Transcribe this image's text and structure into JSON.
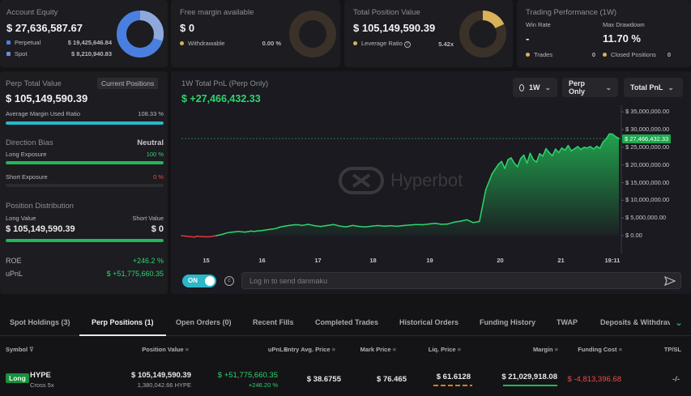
{
  "equity": {
    "label": "Account Equity",
    "value": "$ 27,636,587.67",
    "perp_label": "Perpetual",
    "perp_value": "$ 19,425,646.84",
    "spot_label": "Spot",
    "spot_value": "$ 8,210,940.83"
  },
  "margin": {
    "label": "Free margin available",
    "value": "$ 0",
    "withdrawable_label": "Withdrawable",
    "withdrawable_value": "0.00 %"
  },
  "position": {
    "label": "Total Position Value",
    "value": "$ 105,149,590.39",
    "leverage_label": "Leverage Ratio",
    "leverage_value": "5.42x"
  },
  "performance": {
    "label": "Trading Performance (1W)",
    "win_rate_label": "Win Rate",
    "win_rate_value": "-",
    "drawdown_label": "Max Drawdown",
    "drawdown_value": "11.70 %",
    "trades_label": "Trades",
    "trades_value": "0",
    "closed_label": "Closed Positions",
    "closed_value": "0"
  },
  "perp": {
    "label": "Perp Total Value",
    "current_btn": "Current Positions",
    "value": "$ 105,149,590.39",
    "margin_ratio_label": "Average Margin Used Ratio",
    "margin_ratio_value": "108.33 %",
    "bias_label": "Direction Bias",
    "bias_value": "Neutral",
    "long_label": "Long Exposure",
    "long_value": "100 %",
    "short_label": "Short Exposure",
    "short_value": "0 %",
    "dist_label": "Position Distribution",
    "long_value_label": "Long Value",
    "short_value_label": "Short Value",
    "long_amount": "$ 105,149,590.39",
    "short_amount": "$ 0",
    "roe_label": "ROE",
    "roe_value": "+246.2 %",
    "upnl_label": "uPnL",
    "upnl_value": "$ +51,775,660.35"
  },
  "chart": {
    "title": "1W Total PnL (Perp Only)",
    "value": "$ +27,466,432.33",
    "range_label": "1W",
    "filter_label": "Perp Only",
    "metric_label": "Total PnL",
    "watermark": "Hyperbot",
    "toggle_label": "ON",
    "danmaku_placeholder": "Log in to send danmaku"
  },
  "chart_data": {
    "type": "area",
    "x_ticks": [
      "15",
      "16",
      "17",
      "18",
      "19",
      "20",
      "21",
      "19:11"
    ],
    "y_ticks": [
      "$ 35,000,000.00",
      "$ 30,000,000.00",
      "$ 25,000,000.00",
      "$ 20,000,000.00",
      "$ 15,000,000.00",
      "$ 10,000,000.00",
      "$ 5,000,000.00",
      "$ 0.00"
    ],
    "ylim": [
      0,
      35000000
    ],
    "current_label": "$ 27,466,432.33",
    "current_value": 27466432.33,
    "x": [
      0,
      0.05,
      0.1,
      0.15,
      0.2,
      0.25,
      0.3,
      0.35,
      0.4,
      0.45,
      0.5,
      0.55,
      0.6,
      0.65,
      0.7,
      0.75,
      0.8,
      0.85,
      0.9,
      0.95,
      1.0,
      1.05,
      1.1,
      1.15,
      1.2,
      1.25,
      1.3,
      1.35,
      1.4,
      1.45,
      1.5,
      1.55,
      1.6,
      1.65,
      1.7,
      1.75,
      1.8,
      1.85,
      1.9,
      1.95,
      2.0,
      2.1,
      2.2,
      2.3,
      2.4,
      2.5,
      2.6,
      2.7,
      2.8,
      2.9,
      3.0,
      3.1,
      3.2,
      3.3,
      3.4,
      3.5,
      3.6,
      3.7,
      3.8,
      3.9,
      4.0,
      4.1,
      4.2,
      4.3,
      4.4,
      4.5,
      4.6,
      4.7,
      4.8,
      4.9,
      5.0,
      5.05,
      5.1,
      5.15,
      5.2,
      5.25,
      5.3,
      5.35,
      5.4,
      5.45,
      5.5,
      5.55,
      5.6,
      5.65,
      5.7,
      5.75,
      5.8,
      5.85,
      5.9,
      5.95,
      6.0,
      6.05,
      6.1,
      6.15,
      6.2,
      6.25,
      6.3,
      6.35,
      6.4,
      6.45,
      6.5,
      6.55,
      6.6,
      6.65,
      6.7,
      6.75,
      6.8,
      6.85,
      6.9
    ],
    "y": [
      0,
      -100000,
      -200000,
      -300000,
      -400000,
      -150000,
      -300000,
      -250000,
      -350000,
      -300000,
      -150000,
      0,
      200000,
      400000,
      700000,
      900000,
      1000000,
      1100000,
      1200000,
      1100000,
      1000000,
      1150000,
      1300000,
      1200000,
      1350000,
      1400000,
      1550000,
      1650000,
      1800000,
      1900000,
      2100000,
      2400000,
      2600000,
      2750000,
      2900000,
      3000000,
      3100000,
      3050000,
      2900000,
      3050000,
      3200000,
      2800000,
      2600000,
      2900000,
      3150000,
      2700000,
      2500000,
      2900000,
      2600000,
      2450000,
      2700000,
      2850000,
      2700000,
      2800000,
      2650000,
      2850000,
      3000000,
      3150000,
      3100000,
      3300000,
      3500000,
      3200000,
      3300000,
      3800000,
      4100000,
      4500000,
      3700000,
      4000000,
      13000000,
      17500000,
      20200000,
      21000000,
      19000000,
      21500000,
      22000000,
      20500000,
      19500000,
      21800000,
      22800000,
      20500000,
      23300000,
      21500000,
      20800000,
      23200000,
      22500000,
      24600000,
      23500000,
      22600000,
      24500000,
      23500000,
      24800000,
      24200000,
      25500000,
      24000000,
      24600000,
      25200000,
      24400000,
      25000000,
      24800000,
      25200000,
      24500000,
      25300000,
      24700000,
      26500000,
      27400000,
      28800000,
      28700000,
      28000000,
      27466432
    ]
  },
  "tabs": [
    "Spot Holdings (3)",
    "Perp Positions (1)",
    "Open Orders (0)",
    "Recent Fills",
    "Completed Trades",
    "Historical Orders",
    "Funding History",
    "TWAP",
    "Deposits & Withdrav"
  ],
  "table": {
    "headers": [
      "Symbol",
      "Position Value",
      "uPnL",
      "Entry Avg. Price",
      "Mark Price",
      "Liq. Price",
      "Margin",
      "Funding Cost",
      "TP/SL"
    ],
    "row": {
      "side": "Long",
      "symbol": "HYPE",
      "mode": "Cross 5x",
      "pos_value": "$ 105,149,590.39",
      "pos_qty": "1,380,042.66 HYPE",
      "upnl": "$ +51,775,660.35",
      "upnl_pct": "+246.20 %",
      "entry": "$ 38.6755",
      "mark": "$ 76.465",
      "liq": "$ 61.6128",
      "margin": "$ 21,029,918.08",
      "funding": "$ -4,813,396.68",
      "tpsl": "-/-"
    }
  },
  "colors": {
    "accent": "#2fd46f",
    "negative": "#f0494a",
    "blue": "#4a7fe0",
    "gold": "#d9b15a",
    "teal": "#2ab7c8"
  }
}
